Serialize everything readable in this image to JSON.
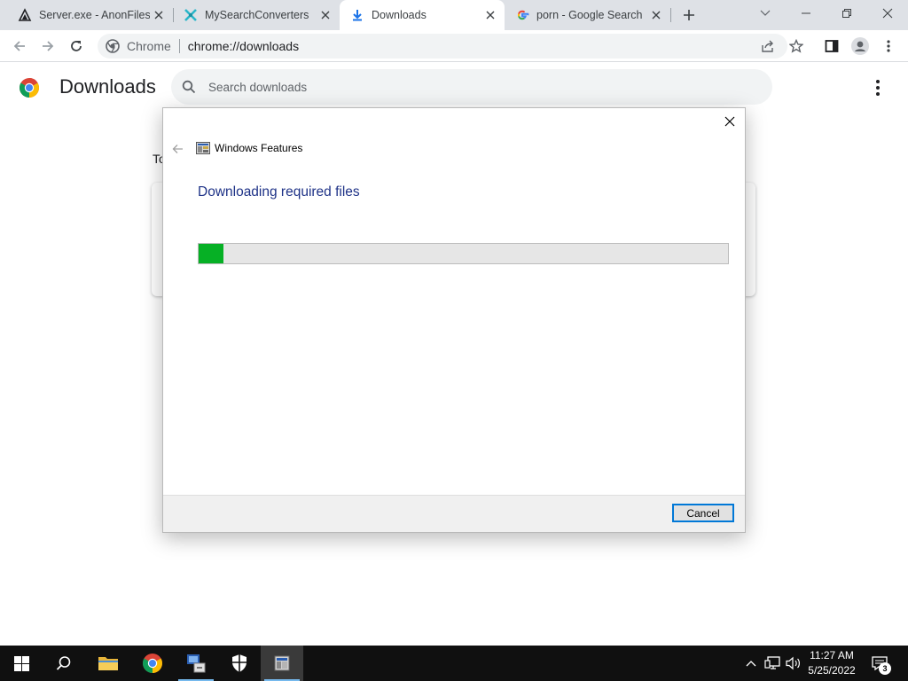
{
  "browser": {
    "tabs": [
      {
        "title": "Server.exe - AnonFiles",
        "icon": "anonfiles-favicon"
      },
      {
        "title": "MySearchConverters",
        "icon": "mysearchconverters-favicon"
      },
      {
        "title": "Downloads",
        "icon": "download-favicon",
        "active": true
      },
      {
        "title": "porn - Google Search",
        "icon": "google-favicon"
      }
    ],
    "omnibox": {
      "scheme_label": "Chrome",
      "url": "chrome://downloads"
    }
  },
  "downloads_page": {
    "title": "Downloads",
    "search_placeholder": "Search downloads",
    "section_label": "To"
  },
  "dialog": {
    "app_title": "Windows Features",
    "heading": "Downloading required files",
    "progress_fraction": 0.047,
    "cancel_label": "Cancel"
  },
  "taskbar": {
    "pinned": [
      "start-icon",
      "search-icon",
      "file-explorer-icon",
      "chrome-icon",
      "network-app-icon",
      "security-icon",
      "windows-features-icon"
    ],
    "clock_time": "11:27 AM",
    "clock_date": "5/25/2022",
    "notification_count": "3"
  },
  "colors": {
    "progress_fill": "#06b025",
    "dialog_heading": "#1e3287",
    "cancel_focus": "#0078d7",
    "tab_strip": "#dee1e6"
  }
}
